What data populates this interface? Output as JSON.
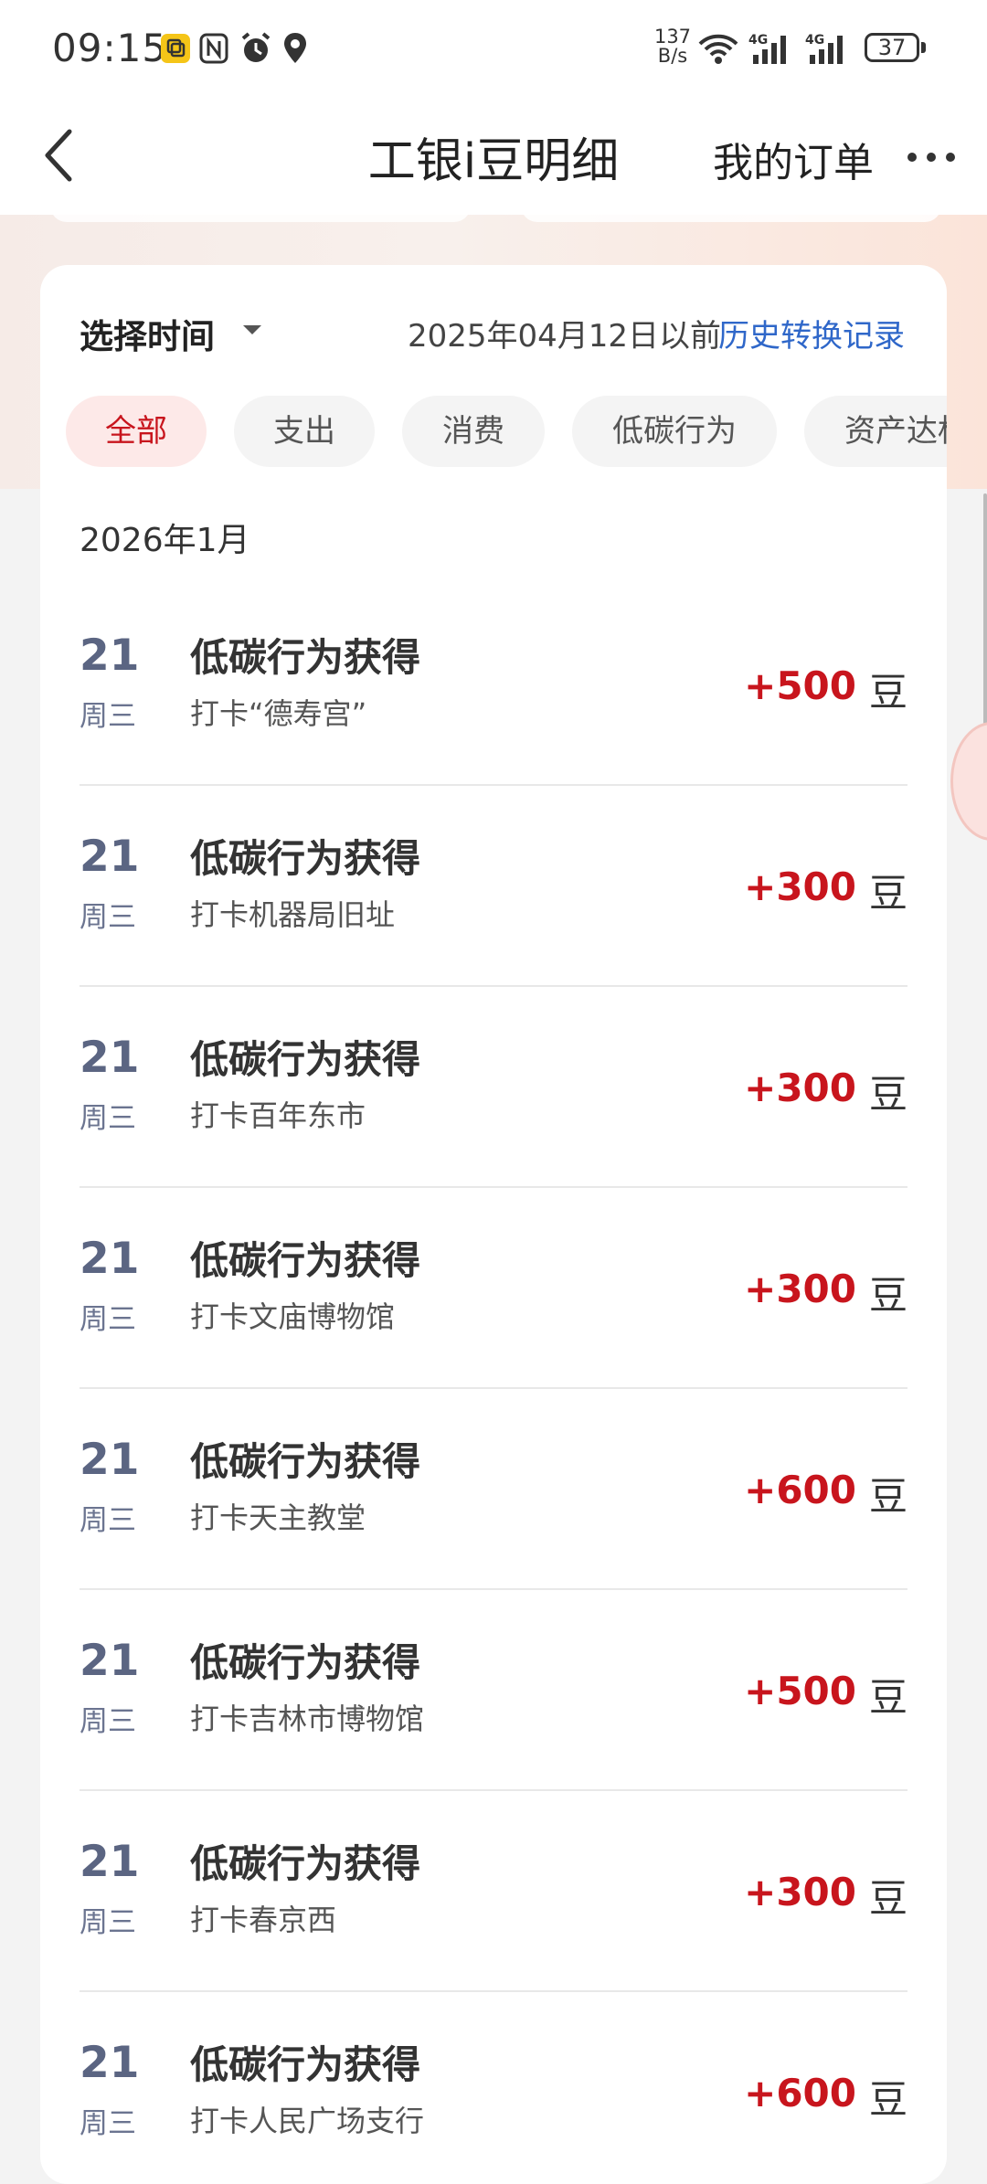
{
  "status_bar": {
    "time": "09:15",
    "net_speed": "137\nB/s",
    "net_speed_top": "137",
    "net_speed_bottom": "B/s",
    "signal1_label": "4G",
    "signal2_label": "4G",
    "battery": "37"
  },
  "nav": {
    "title": "工银i豆明细",
    "orders_link": "我的订单"
  },
  "filter": {
    "label": "选择时间",
    "before_date": "2025年04月12日以前",
    "history_link": "历史转换记录"
  },
  "tabs": [
    {
      "label": "全部",
      "active": true
    },
    {
      "label": "支出",
      "active": false
    },
    {
      "label": "消费",
      "active": false
    },
    {
      "label": "低碳行为",
      "active": false
    },
    {
      "label": "资产达标",
      "active": false
    }
  ],
  "month": "2026年1月",
  "records": [
    {
      "day": "21",
      "weekday": "周三",
      "title": "低碳行为获得",
      "sub": "打卡“德寿宫”",
      "amount": "+500",
      "unit": "豆"
    },
    {
      "day": "21",
      "weekday": "周三",
      "title": "低碳行为获得",
      "sub": "打卡机器局旧址",
      "amount": "+300",
      "unit": "豆"
    },
    {
      "day": "21",
      "weekday": "周三",
      "title": "低碳行为获得",
      "sub": "打卡百年东市",
      "amount": "+300",
      "unit": "豆"
    },
    {
      "day": "21",
      "weekday": "周三",
      "title": "低碳行为获得",
      "sub": "打卡文庙博物馆",
      "amount": "+300",
      "unit": "豆"
    },
    {
      "day": "21",
      "weekday": "周三",
      "title": "低碳行为获得",
      "sub": "打卡天主教堂",
      "amount": "+600",
      "unit": "豆"
    },
    {
      "day": "21",
      "weekday": "周三",
      "title": "低碳行为获得",
      "sub": "打卡吉林市博物馆",
      "amount": "+500",
      "unit": "豆"
    },
    {
      "day": "21",
      "weekday": "周三",
      "title": "低碳行为获得",
      "sub": "打卡春京西",
      "amount": "+300",
      "unit": "豆"
    },
    {
      "day": "21",
      "weekday": "周三",
      "title": "低碳行为获得",
      "sub": "打卡人民广场支行",
      "amount": "+600",
      "unit": "豆"
    }
  ],
  "colors": {
    "accent_red": "#c8151d",
    "link_blue": "#2f67c9",
    "active_tab_bg": "#fde9e8"
  }
}
